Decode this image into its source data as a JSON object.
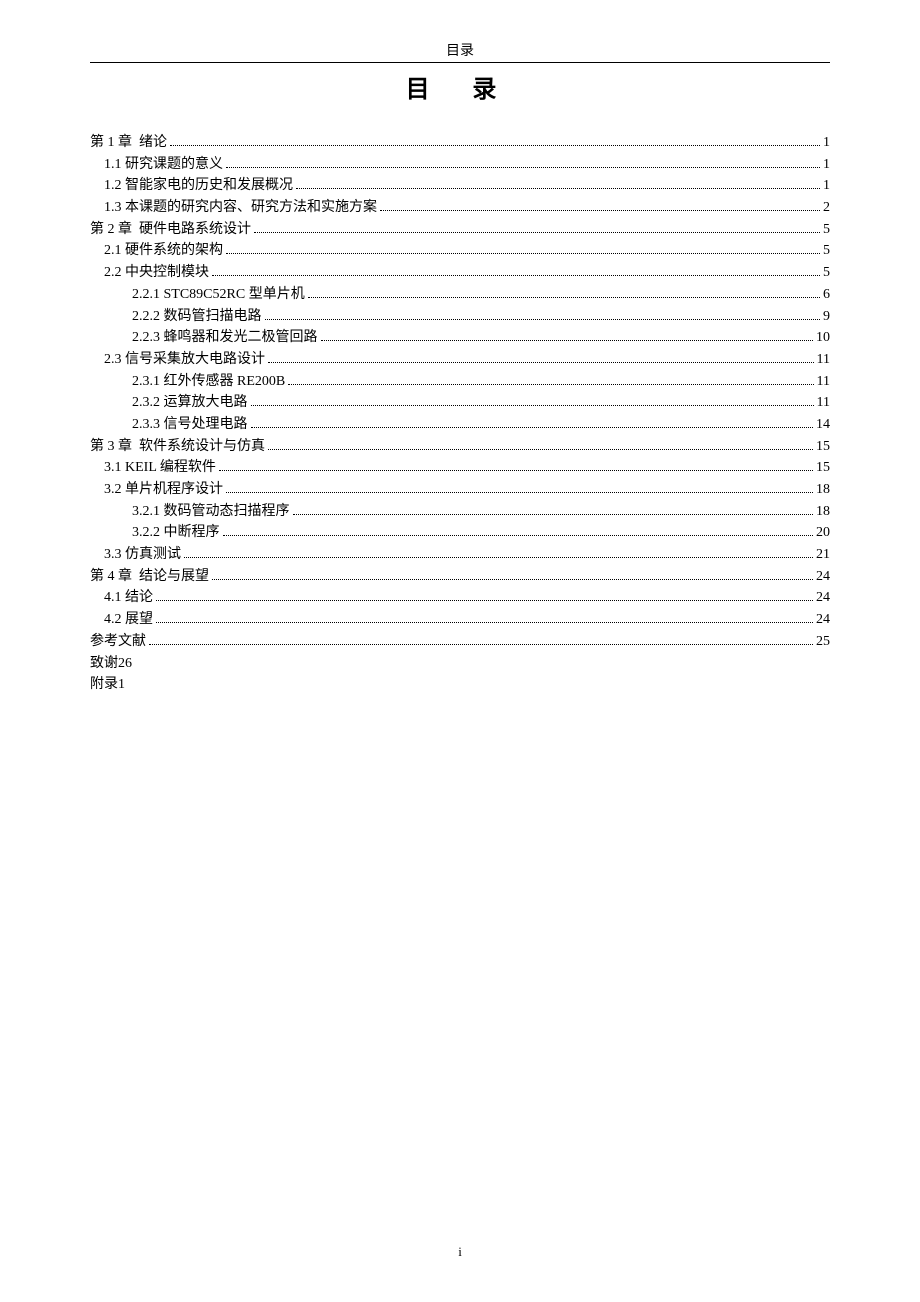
{
  "header_small": "目录",
  "title": "目 录",
  "footer": "i",
  "toc": [
    {
      "label": "第 1 章  绪论",
      "page": "1",
      "indent": 0
    },
    {
      "label": "1.1 研究课题的意义",
      "page": "1",
      "indent": 1
    },
    {
      "label": "1.2 智能家电的历史和发展概况",
      "page": "1",
      "indent": 1
    },
    {
      "label": "1.3 本课题的研究内容、研究方法和实施方案",
      "page": "2",
      "indent": 1
    },
    {
      "label": "第 2 章  硬件电路系统设计",
      "page": "5",
      "indent": 0
    },
    {
      "label": "2.1 硬件系统的架构",
      "page": "5",
      "indent": 1
    },
    {
      "label": "2.2 中央控制模块",
      "page": "5",
      "indent": 1
    },
    {
      "label": "2.2.1 STC89C52RC 型单片机",
      "page": "6",
      "indent": 2
    },
    {
      "label": "2.2.2 数码管扫描电路",
      "page": "9",
      "indent": 2
    },
    {
      "label": "2.2.3 蜂鸣器和发光二极管回路",
      "page": "10",
      "indent": 2
    },
    {
      "label": "2.3 信号采集放大电路设计",
      "page": "11",
      "indent": 1
    },
    {
      "label": "2.3.1 红外传感器 RE200B",
      "page": "11",
      "indent": 2
    },
    {
      "label": "2.3.2 运算放大电路",
      "page": "11",
      "indent": 2
    },
    {
      "label": "2.3.3 信号处理电路",
      "page": "14",
      "indent": 2
    },
    {
      "label": "第 3 章  软件系统设计与仿真",
      "page": "15",
      "indent": 0
    },
    {
      "label": "3.1 KEIL 编程软件",
      "page": "15",
      "indent": 1
    },
    {
      "label": "3.2 单片机程序设计",
      "page": "18",
      "indent": 1
    },
    {
      "label": "3.2.1 数码管动态扫描程序",
      "page": "18",
      "indent": 2
    },
    {
      "label": "3.2.2 中断程序",
      "page": "20",
      "indent": 2
    },
    {
      "label": "3.3 仿真测试",
      "page": "21",
      "indent": 1
    },
    {
      "label": "第 4 章  结论与展望",
      "page": "24",
      "indent": 0
    },
    {
      "label": "4.1 结论",
      "page": "24",
      "indent": 1
    },
    {
      "label": "4.2 展望",
      "page": "24",
      "indent": 1
    },
    {
      "label": "参考文献",
      "page": "25",
      "indent": 0
    },
    {
      "label": "致谢26",
      "page": "",
      "indent": 0,
      "nodots": true
    },
    {
      "label": "附录1",
      "page": "",
      "indent": 0,
      "nodots": true
    }
  ]
}
